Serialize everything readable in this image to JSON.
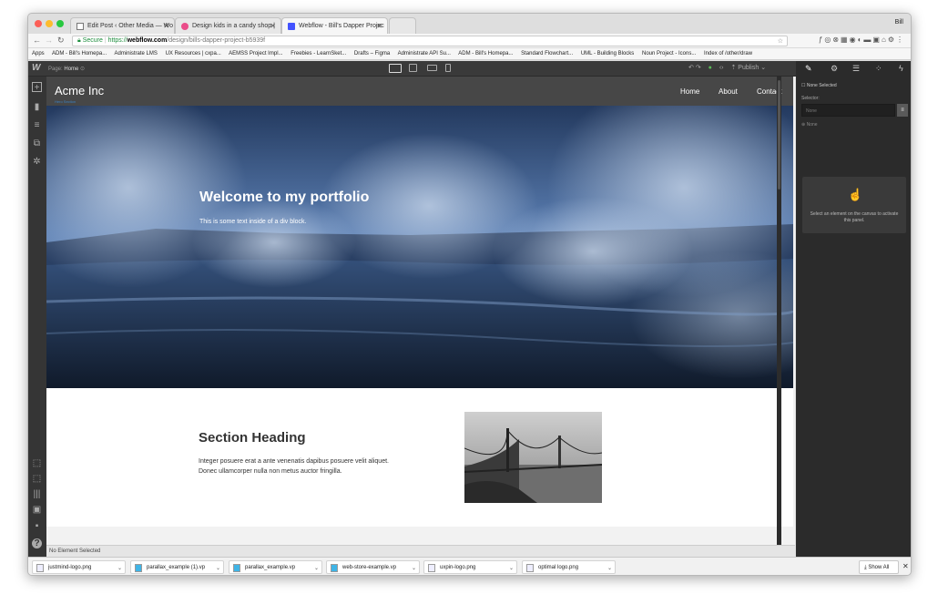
{
  "browser": {
    "tabs": [
      {
        "label": "Edit Post ‹ Other Media — Wo"
      },
      {
        "label": "Design kids in a candy shop |"
      },
      {
        "label": "Webflow - Bill's Dapper Projec"
      }
    ],
    "user": "Bill",
    "secure_label": "Secure",
    "url_scheme": "https://",
    "url_host": "webflow.com",
    "url_path": "/design/bills-dapper-project-b5939f",
    "bookmarks": [
      "Apps",
      "ADM - Bill's Homepa...",
      "Administrate LMS",
      "UX Resources | cxpa...",
      "AEMSS Project Impl...",
      "Freebies - LearnSket...",
      "Drafts – Figma",
      "Administrate API Su...",
      "ADM - Bill's Homepa...",
      "Standard Flowchart...",
      "UML - Building Blocks",
      "Noun Project - Icons...",
      "Index of /other/draw"
    ]
  },
  "designer": {
    "page_prefix": "Page: ",
    "page_name": "Home",
    "publish_label": "Publish",
    "status_text": "No Element Selected"
  },
  "site": {
    "brand": "Acme Inc",
    "header_label": "Hero Section",
    "nav": [
      "Home",
      "About",
      "Contact"
    ],
    "hero_title": "Welcome to my portfolio",
    "hero_text": "This is some text inside of a div block.",
    "section_heading": "Section Heading",
    "section_text": "Integer posuere erat a ante venenatis dapibus posuere velit aliquet. Donec ullamcorper nulla non metus auctor fringilla."
  },
  "panel": {
    "none_selected": "None Selected",
    "selector_label": "Selector:",
    "selector_placeholder": "None",
    "none_label": "None",
    "empty_message": "Select an element on the canvas to activate this panel."
  },
  "downloads": {
    "files": [
      "justmind-logo.png",
      "parallax_example (1).vp",
      "parallax_example.vp",
      "web-store-example.vp",
      "uxpin-logo.png",
      "optimal logo.png"
    ],
    "show_all": "Show All"
  },
  "colors": {
    "accent_blue": "#3b82c4",
    "secure_green": "#1e8e3e",
    "designer_dark": "#2b2b2b"
  }
}
